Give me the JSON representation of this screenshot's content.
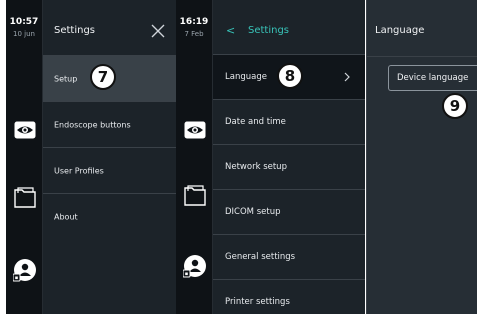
{
  "screen_left": {
    "clock": {
      "time": "10:57",
      "date": "10 jun"
    },
    "rail_icons": [
      "eye-icon",
      "folder-icon",
      "user-lock-icon"
    ],
    "settings_menu": {
      "title": "Settings",
      "close_icon": "close-icon",
      "items": [
        {
          "label": "Setup",
          "selected": true
        },
        {
          "label": "Endoscope buttons",
          "selected": false
        },
        {
          "label": "User Profiles",
          "selected": false
        },
        {
          "label": "About",
          "selected": false
        }
      ]
    }
  },
  "screen_right": {
    "clock": {
      "time": "16:19",
      "date": "7 Feb"
    },
    "rail_icons": [
      "eye-icon",
      "folder-icon",
      "user-lock-icon"
    ],
    "setup_menu": {
      "back_icon": "<",
      "title": "Settings",
      "items": [
        {
          "label": "Language",
          "selected": true
        },
        {
          "label": "Date and time",
          "selected": false
        },
        {
          "label": "Network setup",
          "selected": false
        },
        {
          "label": "DICOM setup",
          "selected": false
        },
        {
          "label": "General settings",
          "selected": false
        },
        {
          "label": "Printer settings",
          "selected": false
        }
      ]
    },
    "language_panel": {
      "title": "Language",
      "device_language_label": "Device language"
    }
  },
  "callouts": [
    "7",
    "8",
    "9"
  ],
  "colors": {
    "accent": "#38c3b8",
    "panel_bg": "#1c2329",
    "rail_bg": "#0e1216",
    "selected_bg": "#394148"
  }
}
